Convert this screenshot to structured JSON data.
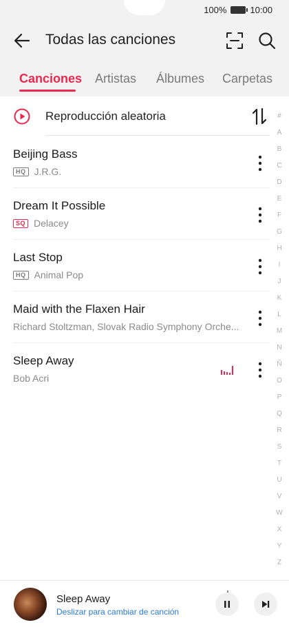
{
  "status_bar": {
    "battery_percent": "100%",
    "time": "10:00"
  },
  "header": {
    "title": "Todas las canciones"
  },
  "tabs": [
    {
      "label": "Canciones",
      "active": true
    },
    {
      "label": "Artistas",
      "active": false
    },
    {
      "label": "Álbumes",
      "active": false
    },
    {
      "label": "Carpetas",
      "active": false
    }
  ],
  "shuffle": {
    "label": "Reproducción aleatoria"
  },
  "songs": [
    {
      "title": "Beijing Bass",
      "badge": "HQ",
      "artist": "J.R.G."
    },
    {
      "title": "Dream It Possible",
      "badge": "SQ",
      "artist": "Delacey"
    },
    {
      "title": "Last Stop",
      "badge": "HQ",
      "artist": "Animal Pop"
    },
    {
      "title": "Maid with the Flaxen Hair",
      "badge": "",
      "artist": "Richard Stoltzman, Slovak Radio Symphony Orche..."
    },
    {
      "title": "Sleep Away",
      "badge": "",
      "artist": "Bob Acri",
      "playing": true
    }
  ],
  "index_letters": [
    "#",
    "A",
    "B",
    "C",
    "D",
    "E",
    "F",
    "G",
    "H",
    "I",
    "J",
    "K",
    "L",
    "M",
    "N",
    "Ñ",
    "O",
    "P",
    "Q",
    "R",
    "S",
    "T",
    "U",
    "V",
    "W",
    "X",
    "Y",
    "Z"
  ],
  "player": {
    "title": "Sleep Away",
    "subtitle": "Deslizar para cambiar de canción"
  },
  "colors": {
    "accent": "#e8284f",
    "link": "#2a7ad8",
    "topbar": "#f2f2f2"
  }
}
